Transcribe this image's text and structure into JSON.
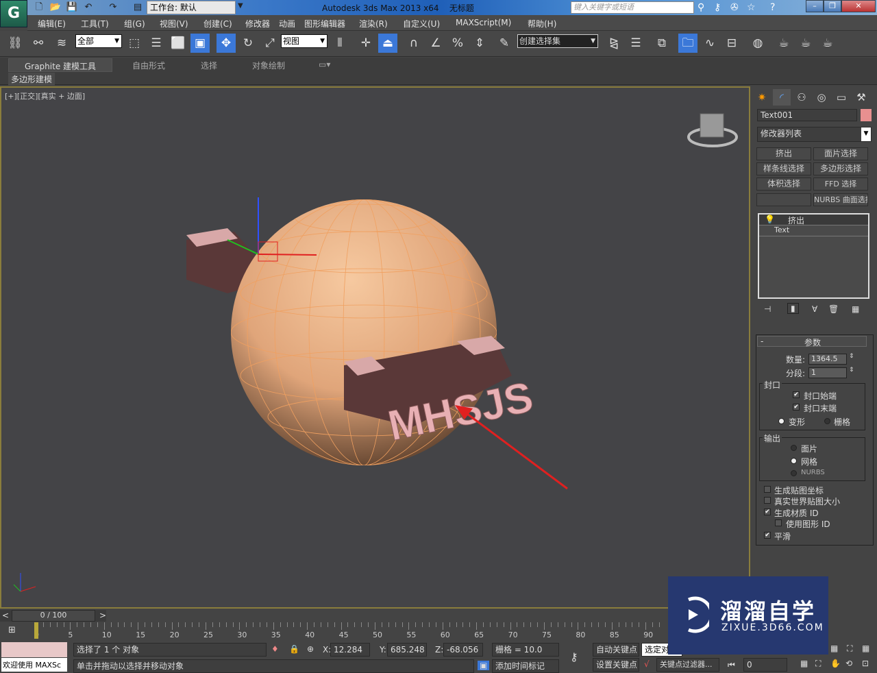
{
  "titlebar": {
    "workspace": "工作台: 默认",
    "app_title": "Autodesk 3ds Max  2013 x64",
    "doc_title": "无标题",
    "search_placeholder": "键入关键字或短语"
  },
  "menu": [
    "编辑(E)",
    "工具(T)",
    "组(G)",
    "视图(V)",
    "创建(C)",
    "修改器",
    "动画",
    "图形编辑器",
    "渲染(R)",
    "自定义(U)",
    "MAXScript(M)",
    "帮助(H)"
  ],
  "toolbar": {
    "selection_filter": "全部",
    "ref_coord": "视图",
    "named_selection": "创建选择集"
  },
  "ribbon": {
    "tabs": [
      "Graphite 建模工具",
      "自由形式",
      "选择",
      "对象绘制"
    ],
    "subtab": "多边形建模"
  },
  "viewport": {
    "label": "[+][正交][真实 + 边面]",
    "object_text": "MHSJS",
    "accent": "#e02020"
  },
  "command_panel": {
    "object_name": "Text001",
    "object_color": "#e89090",
    "modifier_list": "修改器列表",
    "modifier_buttons": [
      "挤出",
      "面片选择",
      "样条线选择",
      "多边形选择",
      "体积选择",
      "FFD 选择",
      "",
      "NURBS 曲面选择"
    ],
    "stack": [
      "挤出",
      "Text"
    ],
    "params": {
      "title": "参数",
      "amount_label": "数量:",
      "amount": "1364.5",
      "segments_label": "分段:",
      "segments": "1",
      "cap_group": "封口",
      "cap_start": "封口始端",
      "cap_end": "封口末端",
      "morph": "变形",
      "grid": "栅格",
      "output_group": "输出",
      "patch": "面片",
      "mesh": "网格",
      "nurbs": "NURBS",
      "gen_map": "生成贴图坐标",
      "real_world": "真实世界贴图大小",
      "gen_mat": "生成材质 ID",
      "use_shape": "使用图形 ID",
      "smooth": "平滑"
    },
    "checks": {
      "cap_start": true,
      "cap_end": true,
      "gen_map": false,
      "real_world": false,
      "gen_mat": true,
      "use_shape": false,
      "smooth": true
    },
    "cap_type": "变形",
    "output_type": "网格"
  },
  "timeline": {
    "frame": "0 / 100",
    "ticks": [
      "0",
      "5",
      "10",
      "15",
      "20",
      "25",
      "30",
      "35",
      "40",
      "45",
      "50",
      "55",
      "60",
      "65",
      "70",
      "75",
      "80",
      "85",
      "90"
    ]
  },
  "status": {
    "welcome": "欢迎使用 MAXSc",
    "selected": "选择了 1 个 对象",
    "prompt": "单击并拖动以选择并移动对象",
    "x_label": "X:",
    "x": "12.284",
    "y_label": "Y:",
    "y": "685.248",
    "z_label": "Z:",
    "z": "-68.056",
    "grid": "栅格 = 10.0",
    "add_tag": "添加时间标记",
    "auto_key": "自动关键点",
    "set_key": "设置关键点",
    "selected_dd": "选定对",
    "key_filter": "关键点过滤器...",
    "frame_field": "0"
  },
  "watermark": {
    "name": "溜溜自学",
    "url": "ZIXUE.3D66.COM"
  }
}
